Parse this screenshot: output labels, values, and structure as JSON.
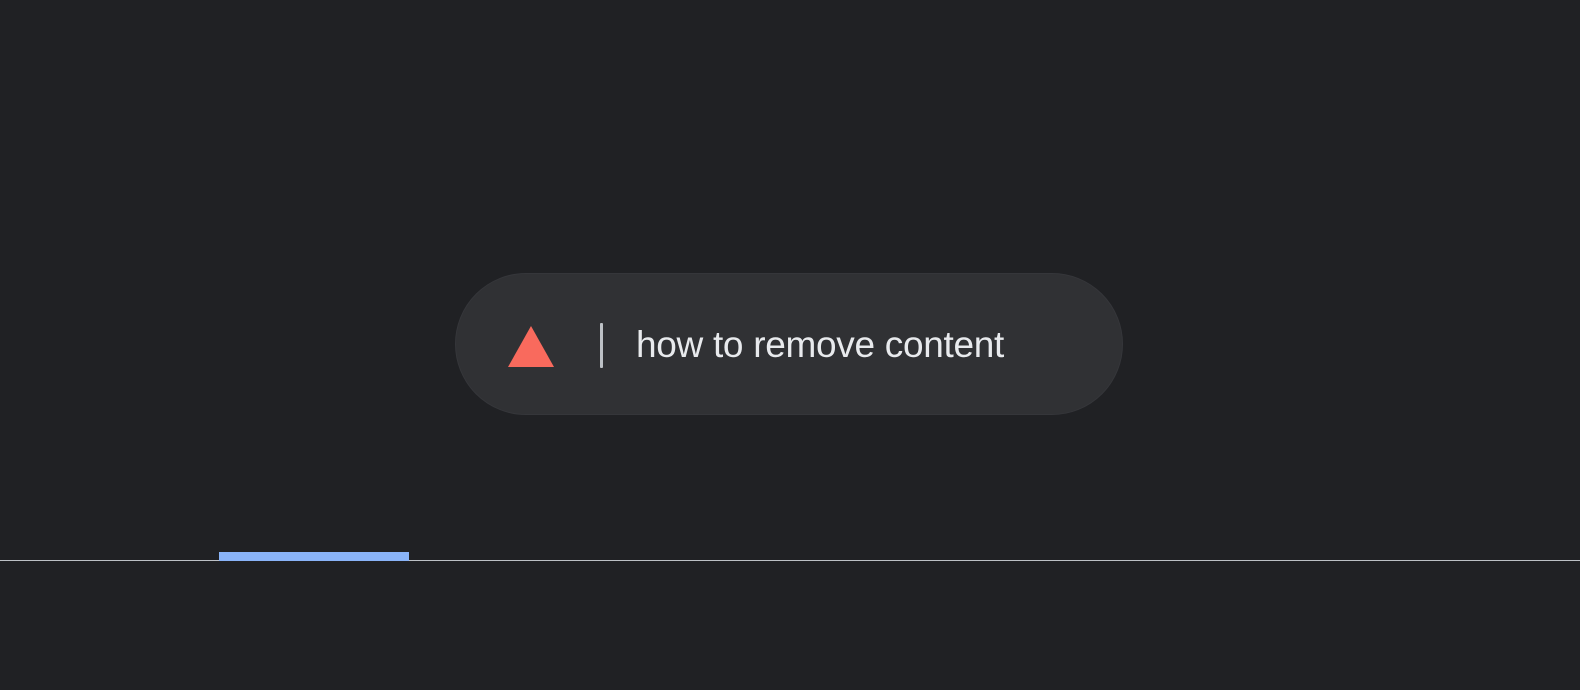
{
  "search": {
    "query": "how to remove content",
    "icon": "warning-triangle-icon",
    "icon_color": "#f28b82"
  },
  "colors": {
    "background": "#202124",
    "pill": "#303134",
    "text": "#e8eaed",
    "accent": "#8ab4f8"
  }
}
